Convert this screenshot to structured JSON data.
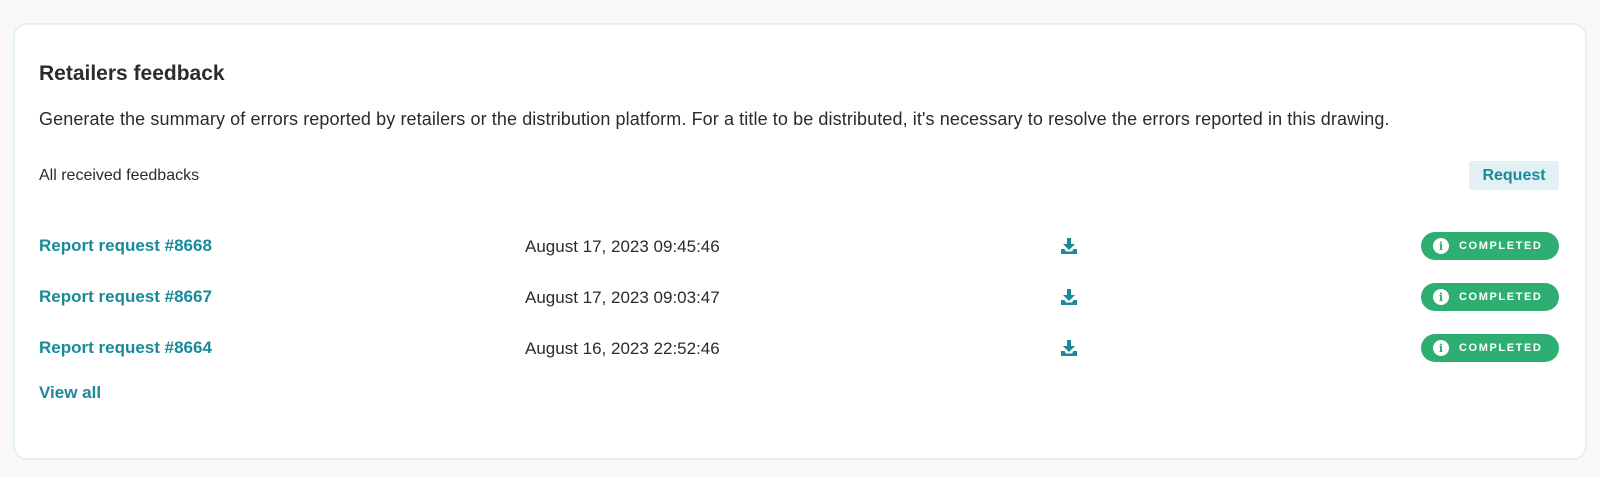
{
  "card": {
    "title": "Retailers feedback",
    "description": "Generate the summary of errors reported by retailers or the distribution platform. For a title to be distributed, it's necessary to resolve the errors reported in this drawing.",
    "section_label": "All received feedbacks",
    "request_label": "Request",
    "view_all_label": "View all"
  },
  "reports": [
    {
      "title": "Report request #8668",
      "date": "August 17, 2023 09:45:46",
      "download_icon": "download-icon",
      "status": "COMPLETED",
      "status_icon": "info-icon"
    },
    {
      "title": "Report request #8667",
      "date": "August 17, 2023 09:03:47",
      "download_icon": "download-icon",
      "status": "COMPLETED",
      "status_icon": "info-icon"
    },
    {
      "title": "Report request #8664",
      "date": "August 16, 2023 22:52:46",
      "download_icon": "download-icon",
      "status": "COMPLETED",
      "status_icon": "info-icon"
    }
  ],
  "colors": {
    "accent": "#1a8a9b",
    "status_completed": "#2fae72",
    "request_bg": "#e1f0f2",
    "card_border": "#e2f1f3",
    "page_bg": "#f8f8f8"
  }
}
